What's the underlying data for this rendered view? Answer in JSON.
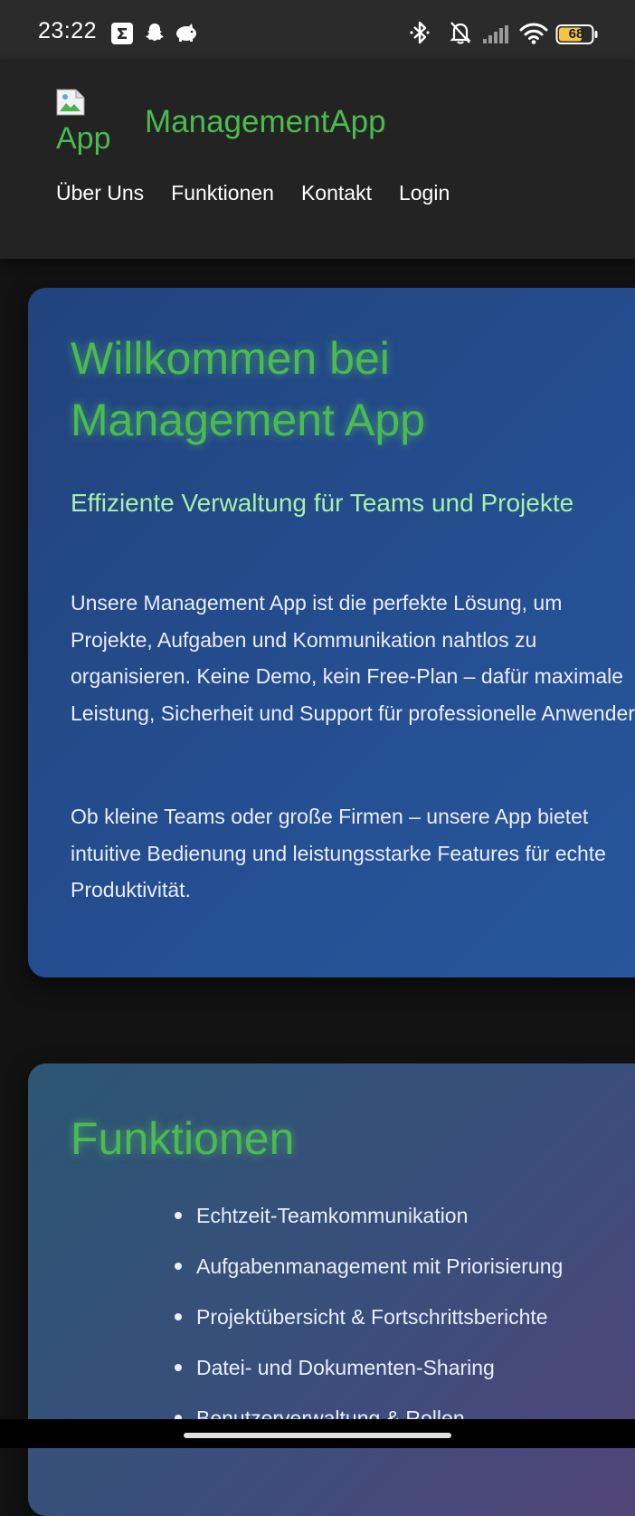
{
  "status_bar": {
    "time": "23:22",
    "battery": "68",
    "icons": [
      "sigma-app-icon",
      "snapchat-icon",
      "piggy-icon",
      "bluetooth-icon",
      "bell-muted-icon",
      "signal-icon",
      "wifi-icon",
      "battery-icon"
    ]
  },
  "header": {
    "logo_alt": "App",
    "brand": "ManagementApp",
    "nav": [
      "Über Uns",
      "Funktionen",
      "Kontakt",
      "Login"
    ]
  },
  "welcome": {
    "title": "Willkommen bei Management App",
    "subtitle": "Effiziente Verwaltung für Teams und Projekte",
    "paragraph1": "Unsere Management App ist die perfekte Lösung, um Projekte, Aufgaben und Kommunikation nahtlos zu organisieren. Keine Demo, kein Free-Plan – dafür maximale Leistung, Sicherheit und Support für professionelle Anwender.",
    "paragraph2": "Ob kleine Teams oder große Firmen – unsere App bietet intuitive Bedienung und leistungsstarke Features für echte Produktivität."
  },
  "features": {
    "title": "Funktionen",
    "items": [
      "Echtzeit-Teamkommunikation",
      "Aufgabenmanagement mit Priorisierung",
      "Projektübersicht & Fortschrittsberichte",
      "Datei- und Dokumenten-Sharing",
      "Benutzerverwaltung & Rollen"
    ]
  },
  "colors": {
    "accent_green": "#4bbb4f",
    "header_bg": "#232323",
    "page_bg": "#121212",
    "welcome_card": "#254f92",
    "features_card": "#3a4e7c"
  }
}
